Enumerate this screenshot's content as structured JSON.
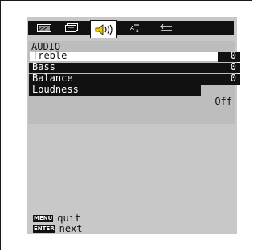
{
  "tabs": [
    {
      "name": "picture-tab",
      "icon": "picture-icon"
    },
    {
      "name": "display-tab",
      "icon": "display-icon"
    },
    {
      "name": "audio-tab",
      "icon": "speaker-icon",
      "active": true
    },
    {
      "name": "setup-tab",
      "icon": "setup-icon"
    },
    {
      "name": "input-tab",
      "icon": "input-icon"
    }
  ],
  "section": {
    "title": "AUDIO"
  },
  "items": [
    {
      "label": "Treble",
      "value": "0"
    },
    {
      "label": "Bass",
      "value": "0"
    },
    {
      "label": "Balance",
      "value": "0"
    },
    {
      "label": "Loudness",
      "value": "Off"
    }
  ],
  "footer": {
    "menu_key": "MENU",
    "menu_action": "quit",
    "enter_key": "ENTER",
    "enter_action": "next"
  },
  "colors": {
    "osd_bg": "#c8c8c8",
    "tab_bar": "#111111",
    "selection_border": "#e8d000"
  }
}
